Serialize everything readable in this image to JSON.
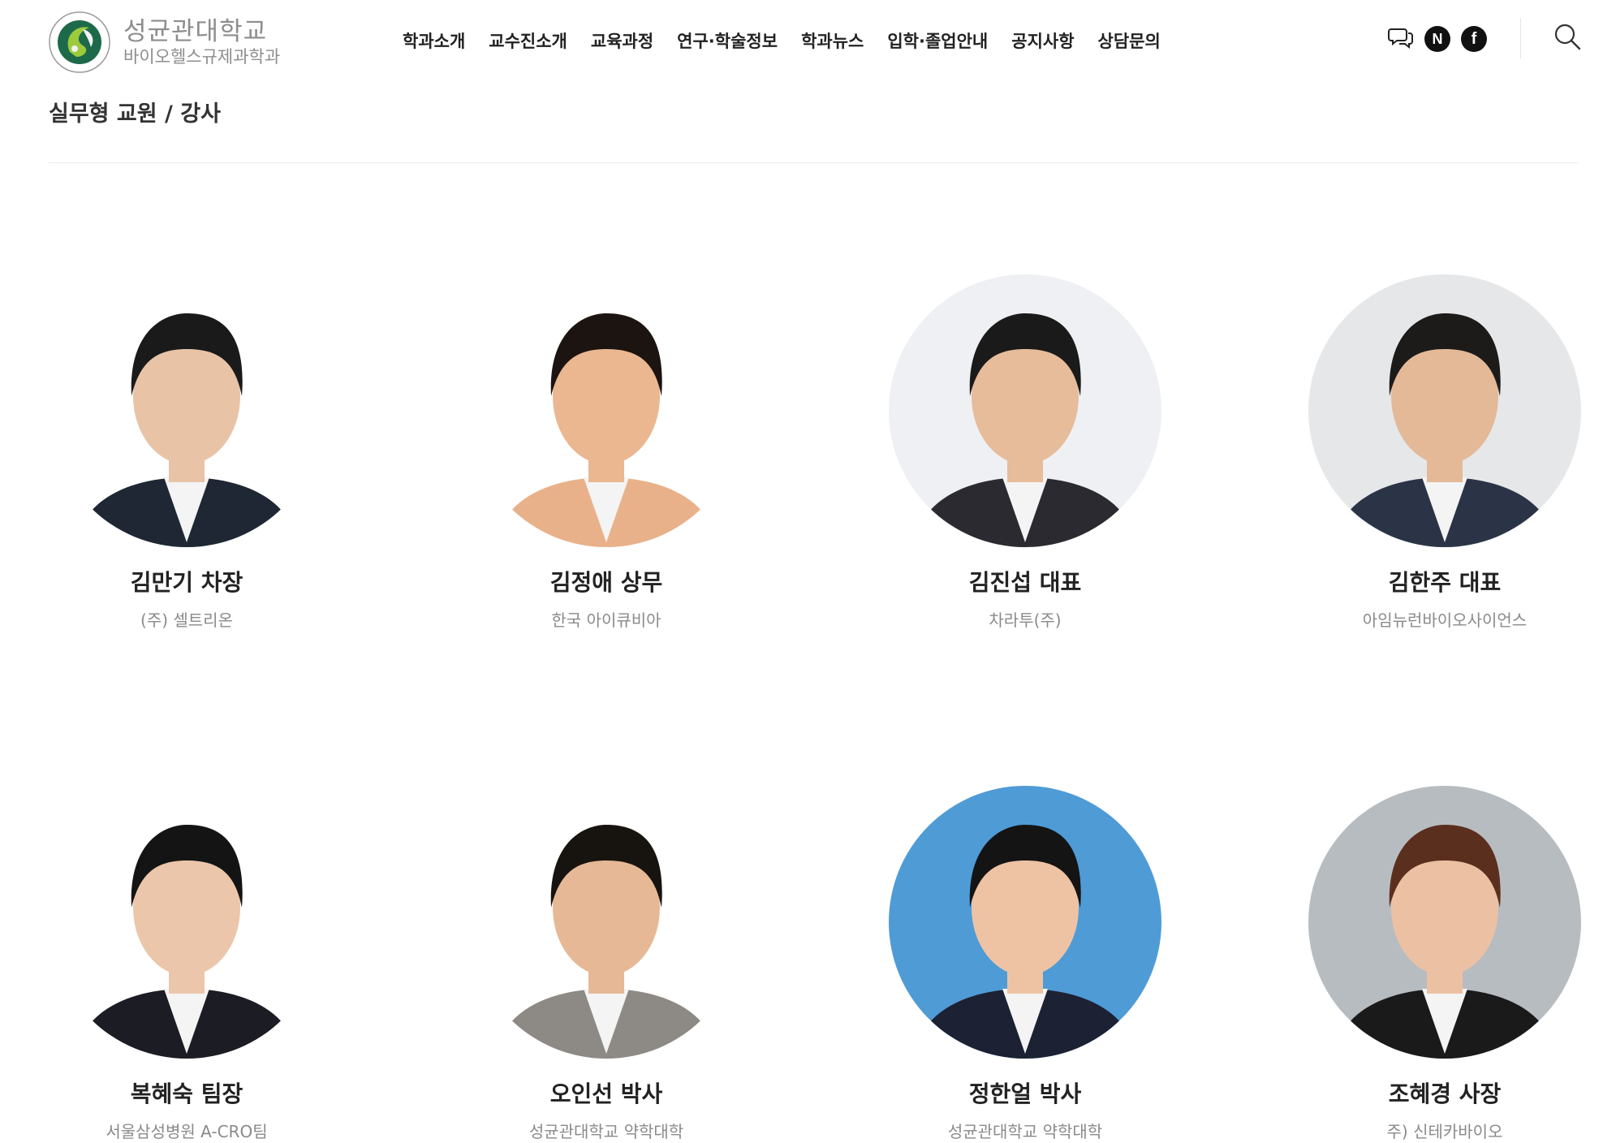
{
  "header": {
    "logo": {
      "university": "성균관대학교",
      "department": "바이오헬스규제과학과"
    },
    "nav": [
      "학과소개",
      "교수진소개",
      "교육과정",
      "연구·학술정보",
      "학과뉴스",
      "입학·졸업안내",
      "공지사항",
      "상담문의"
    ],
    "social": {
      "naver_letter": "N",
      "facebook_letter": "f"
    }
  },
  "page": {
    "title": "실무형 교원 / 강사"
  },
  "staff": [
    {
      "name": "김만기 차장",
      "affiliation": "(주) 셀트리온",
      "bg": "#ffffff",
      "suit": "#1e2733",
      "skin": "#e8c3a6",
      "hair": "#1a1a1a"
    },
    {
      "name": "김정애 상무",
      "affiliation": "한국 아이큐비아",
      "bg": "#ffffff",
      "suit": "#e9b18a",
      "skin": "#eab790",
      "hair": "#1b1410"
    },
    {
      "name": "김진섭 대표",
      "affiliation": "차라투(주)",
      "bg": "#eef0f3",
      "suit": "#2a2a30",
      "skin": "#e7bc9a",
      "hair": "#1a1a1a"
    },
    {
      "name": "김한주 대표",
      "affiliation": "아임뉴런바이오사이언스",
      "bg": "#e6e7e9",
      "suit": "#2b3446",
      "skin": "#e3b998",
      "hair": "#1d1b1a"
    },
    {
      "name": "복혜숙 팀장",
      "affiliation": "서울삼성병원 A-CRO팀",
      "bg": "#ffffff",
      "suit": "#1c1c24",
      "skin": "#ecc6aa",
      "hair": "#141414"
    },
    {
      "name": "오인선 박사",
      "affiliation": "성균관대학교 약학대학",
      "bg": "#ffffff",
      "suit": "#8d8a86",
      "skin": "#e6b895",
      "hair": "#17140f"
    },
    {
      "name": "정한얼 박사",
      "affiliation": "성균관대학교 약학대학",
      "bg": "#4f9bd6",
      "suit": "#1c2133",
      "skin": "#eec3a4",
      "hair": "#141414"
    },
    {
      "name": "조혜경 사장",
      "affiliation": "주) 신테카바이오",
      "bg": "#b7bcc1",
      "suit": "#1a1a1a",
      "skin": "#ecc1a3",
      "hair": "#5b2f1e"
    }
  ]
}
